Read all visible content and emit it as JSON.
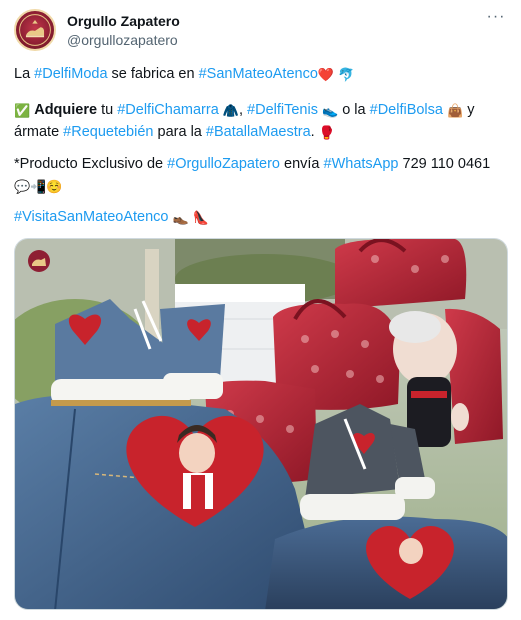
{
  "author": {
    "display_name": "Orgullo Zapatero",
    "handle": "@orgullozapatero"
  },
  "more_label": "···",
  "paragraph1": {
    "t1": "La ",
    "h1": "#DelfiModa",
    "t2": " se fabrica en ",
    "h2": "#SanMateoAtenco",
    "e1": "❤️",
    "e2": "🐬"
  },
  "paragraph2": {
    "e0": "✅",
    "b1": "Adquiere",
    "t1": " tu ",
    "h1": "#DelfiChamarra",
    "e1": "🧥",
    "t2": ", ",
    "h2": "#DelfiTenis",
    "e2": "👟",
    "t3": " o la ",
    "h3": "#DelfiBolsa",
    "e3": "👜",
    "t4": " y ármate ",
    "h4": "#Requetebién",
    "t5": " para la ",
    "h5": "#BatallaMaestra",
    "t6": ".",
    "e4": "🥊"
  },
  "paragraph3": {
    "t1": "*Producto Exclusivo de ",
    "h1": "#OrgulloZapatero",
    "t2": " envía ",
    "h2": "#WhatsApp",
    "t3": " 729 110 0461 ",
    "e1": "💬",
    "e2": "📲",
    "e3": "☺️"
  },
  "paragraph4": {
    "h1": "#VisitaSanMateoAtenco",
    "e1": "👞",
    "e2": "👠"
  },
  "colors": {
    "hashtag": "#1d9bf0",
    "text": "#0f1419",
    "secondary": "#536471",
    "denim": "#3e5f86",
    "heart_red": "#c8232c",
    "bag_red": "#b52434"
  },
  "icons": {
    "more": "more-dots-icon"
  }
}
